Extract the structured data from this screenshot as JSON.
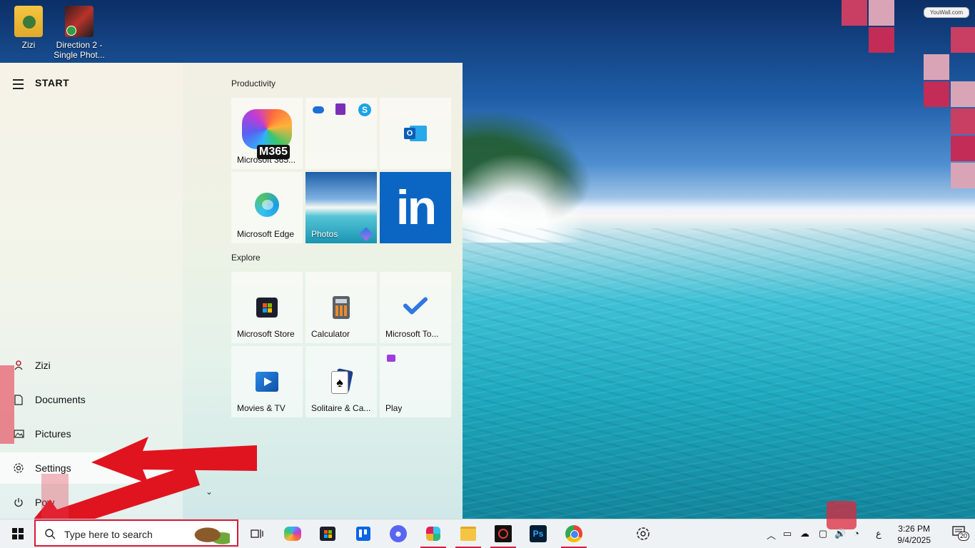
{
  "watermark": "YouWall.com",
  "desktop_icons": [
    {
      "label": "Zizi"
    },
    {
      "label": "Direction 2 -\nSingle Phot..."
    }
  ],
  "start_menu": {
    "title": "START",
    "sidebar": {
      "items": [
        {
          "label": "Zizi",
          "icon": "user-icon"
        },
        {
          "label": "Documents",
          "icon": "document-icon"
        },
        {
          "label": "Pictures",
          "icon": "picture-icon"
        },
        {
          "label": "Settings",
          "icon": "gear-icon"
        },
        {
          "label": "Pow",
          "icon": "power-icon"
        }
      ]
    },
    "groups": [
      {
        "label": "Productivity",
        "tiles": [
          {
            "label": "Microsoft 365...",
            "badge": "M365",
            "icon": "m365-icon"
          },
          {
            "label": "",
            "icon": "office-apps-icon"
          },
          {
            "label": "",
            "icon": "outlook-icon"
          },
          {
            "label": "Microsoft Edge",
            "icon": "edge-icon"
          },
          {
            "label": "Photos",
            "icon": "photos-icon"
          },
          {
            "label": "",
            "icon": "linkedin-icon",
            "text": "in"
          }
        ]
      },
      {
        "label": "Explore",
        "tiles": [
          {
            "label": "Microsoft Store",
            "icon": "store-icon"
          },
          {
            "label": "Calculator",
            "icon": "calculator-icon"
          },
          {
            "label": "Microsoft To...",
            "icon": "todo-icon"
          },
          {
            "label": "Movies & TV",
            "icon": "movies-icon"
          },
          {
            "label": "Solitaire & Ca...",
            "icon": "solitaire-icon"
          },
          {
            "label": "Play",
            "icon": "play-folder-icon"
          }
        ]
      }
    ]
  },
  "taskbar": {
    "search_placeholder": "Type here to search",
    "apps": [
      "task-view-icon",
      "copilot-icon",
      "store-icon",
      "trello-icon",
      "discord-icon",
      "slack-icon",
      "file-explorer-icon",
      "obs-icon",
      "photoshop-icon",
      "chrome-icon",
      "chatgpt-icon"
    ],
    "photoshop_label": "Ps",
    "tray": {
      "language": "ع",
      "time": "3:26 PM",
      "date": "9/4/2025",
      "notification_count": "20"
    }
  },
  "colors": {
    "accent_red": "#d81b3b",
    "linkedin_blue": "#0a66c2"
  }
}
